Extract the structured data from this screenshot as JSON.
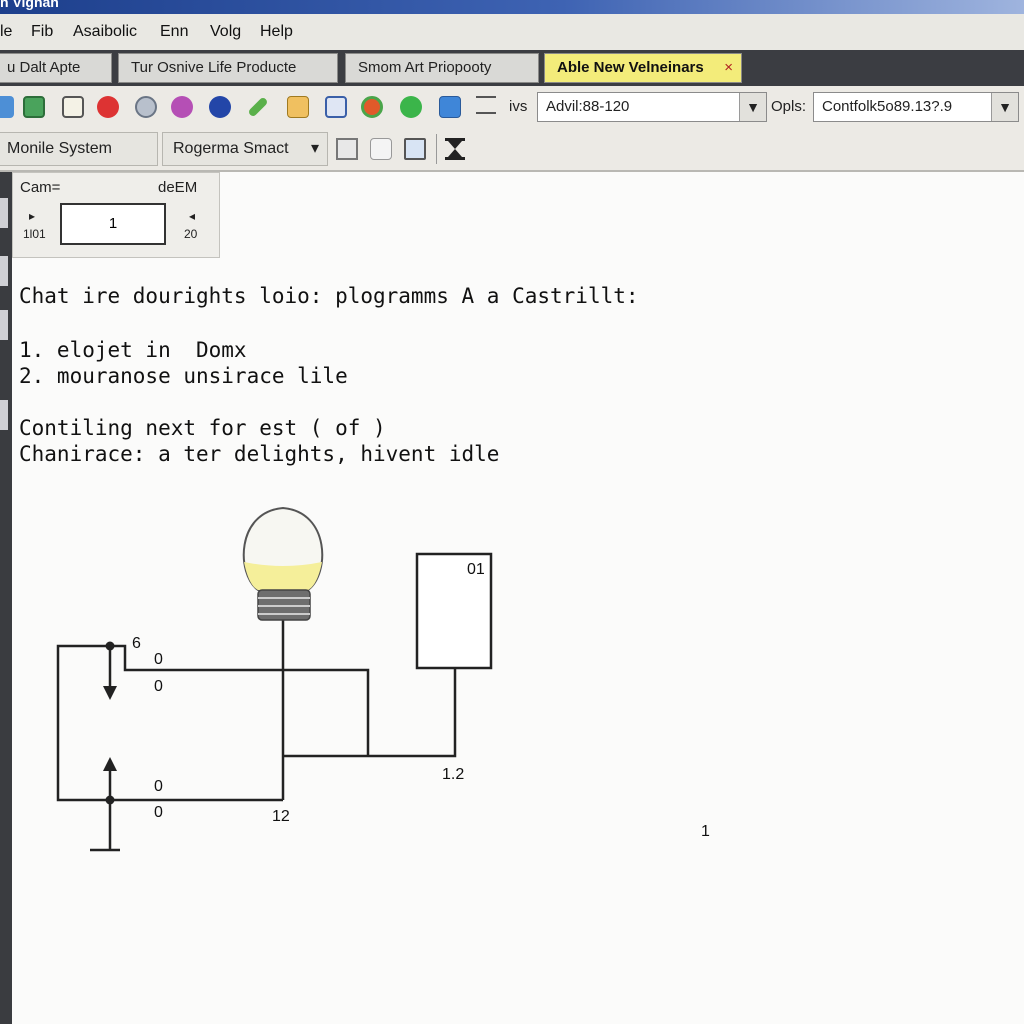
{
  "window": {
    "title": "n Vignan"
  },
  "menu": [
    "le",
    "Fib",
    "Asaibolic",
    "Enn",
    "Volg",
    "Help"
  ],
  "tabs": [
    {
      "label": "u Dalt Apte",
      "active": false
    },
    {
      "label": "Tur Osnive Life Producte",
      "active": false
    },
    {
      "label": "Smom Art Priopooty",
      "active": false
    },
    {
      "label": "Able New Velneinars",
      "active": true,
      "close": "×"
    }
  ],
  "toolbar": {
    "label1": "ivs",
    "combo1_value": "Advil:88-120",
    "label2": "Opls:",
    "combo2_value": "Contfolk5o89.13?.9",
    "dropdown_arrow": "▼"
  },
  "toolbar2": {
    "system_button": "Monile System",
    "program_dropdown": "Rogerma Smact",
    "dropdown_arrow": "▾"
  },
  "spinner": {
    "label_left": "Cam=",
    "label_right": "deEM",
    "left_arrow": "▸",
    "left_value": "1l01",
    "value": "1",
    "right_arrow": "◂",
    "right_value": "20"
  },
  "text_lines": [
    "Chat ire dourights loio: plogramms A a Castrillt:",
    "1. elojet in  Domx",
    "2. mouranose unsirace lile",
    "Contiling next for est ( of )",
    "Chanirace: a ter delights, hivent idle"
  ],
  "diagram": {
    "labels": {
      "top_6": "6",
      "top_0a": "0",
      "top_0b": "0",
      "bot_0a": "0",
      "bot_0b": "0",
      "bottom_12": "12",
      "box_01": "01",
      "right_1_2": "1.2",
      "lone_1": "1"
    }
  },
  "colors": {
    "titlebar": "#1d3f8c",
    "active_tab": "#f3ec7a",
    "sidebar": "#3a3c40",
    "bulb_fill": "#f5ef9a"
  }
}
